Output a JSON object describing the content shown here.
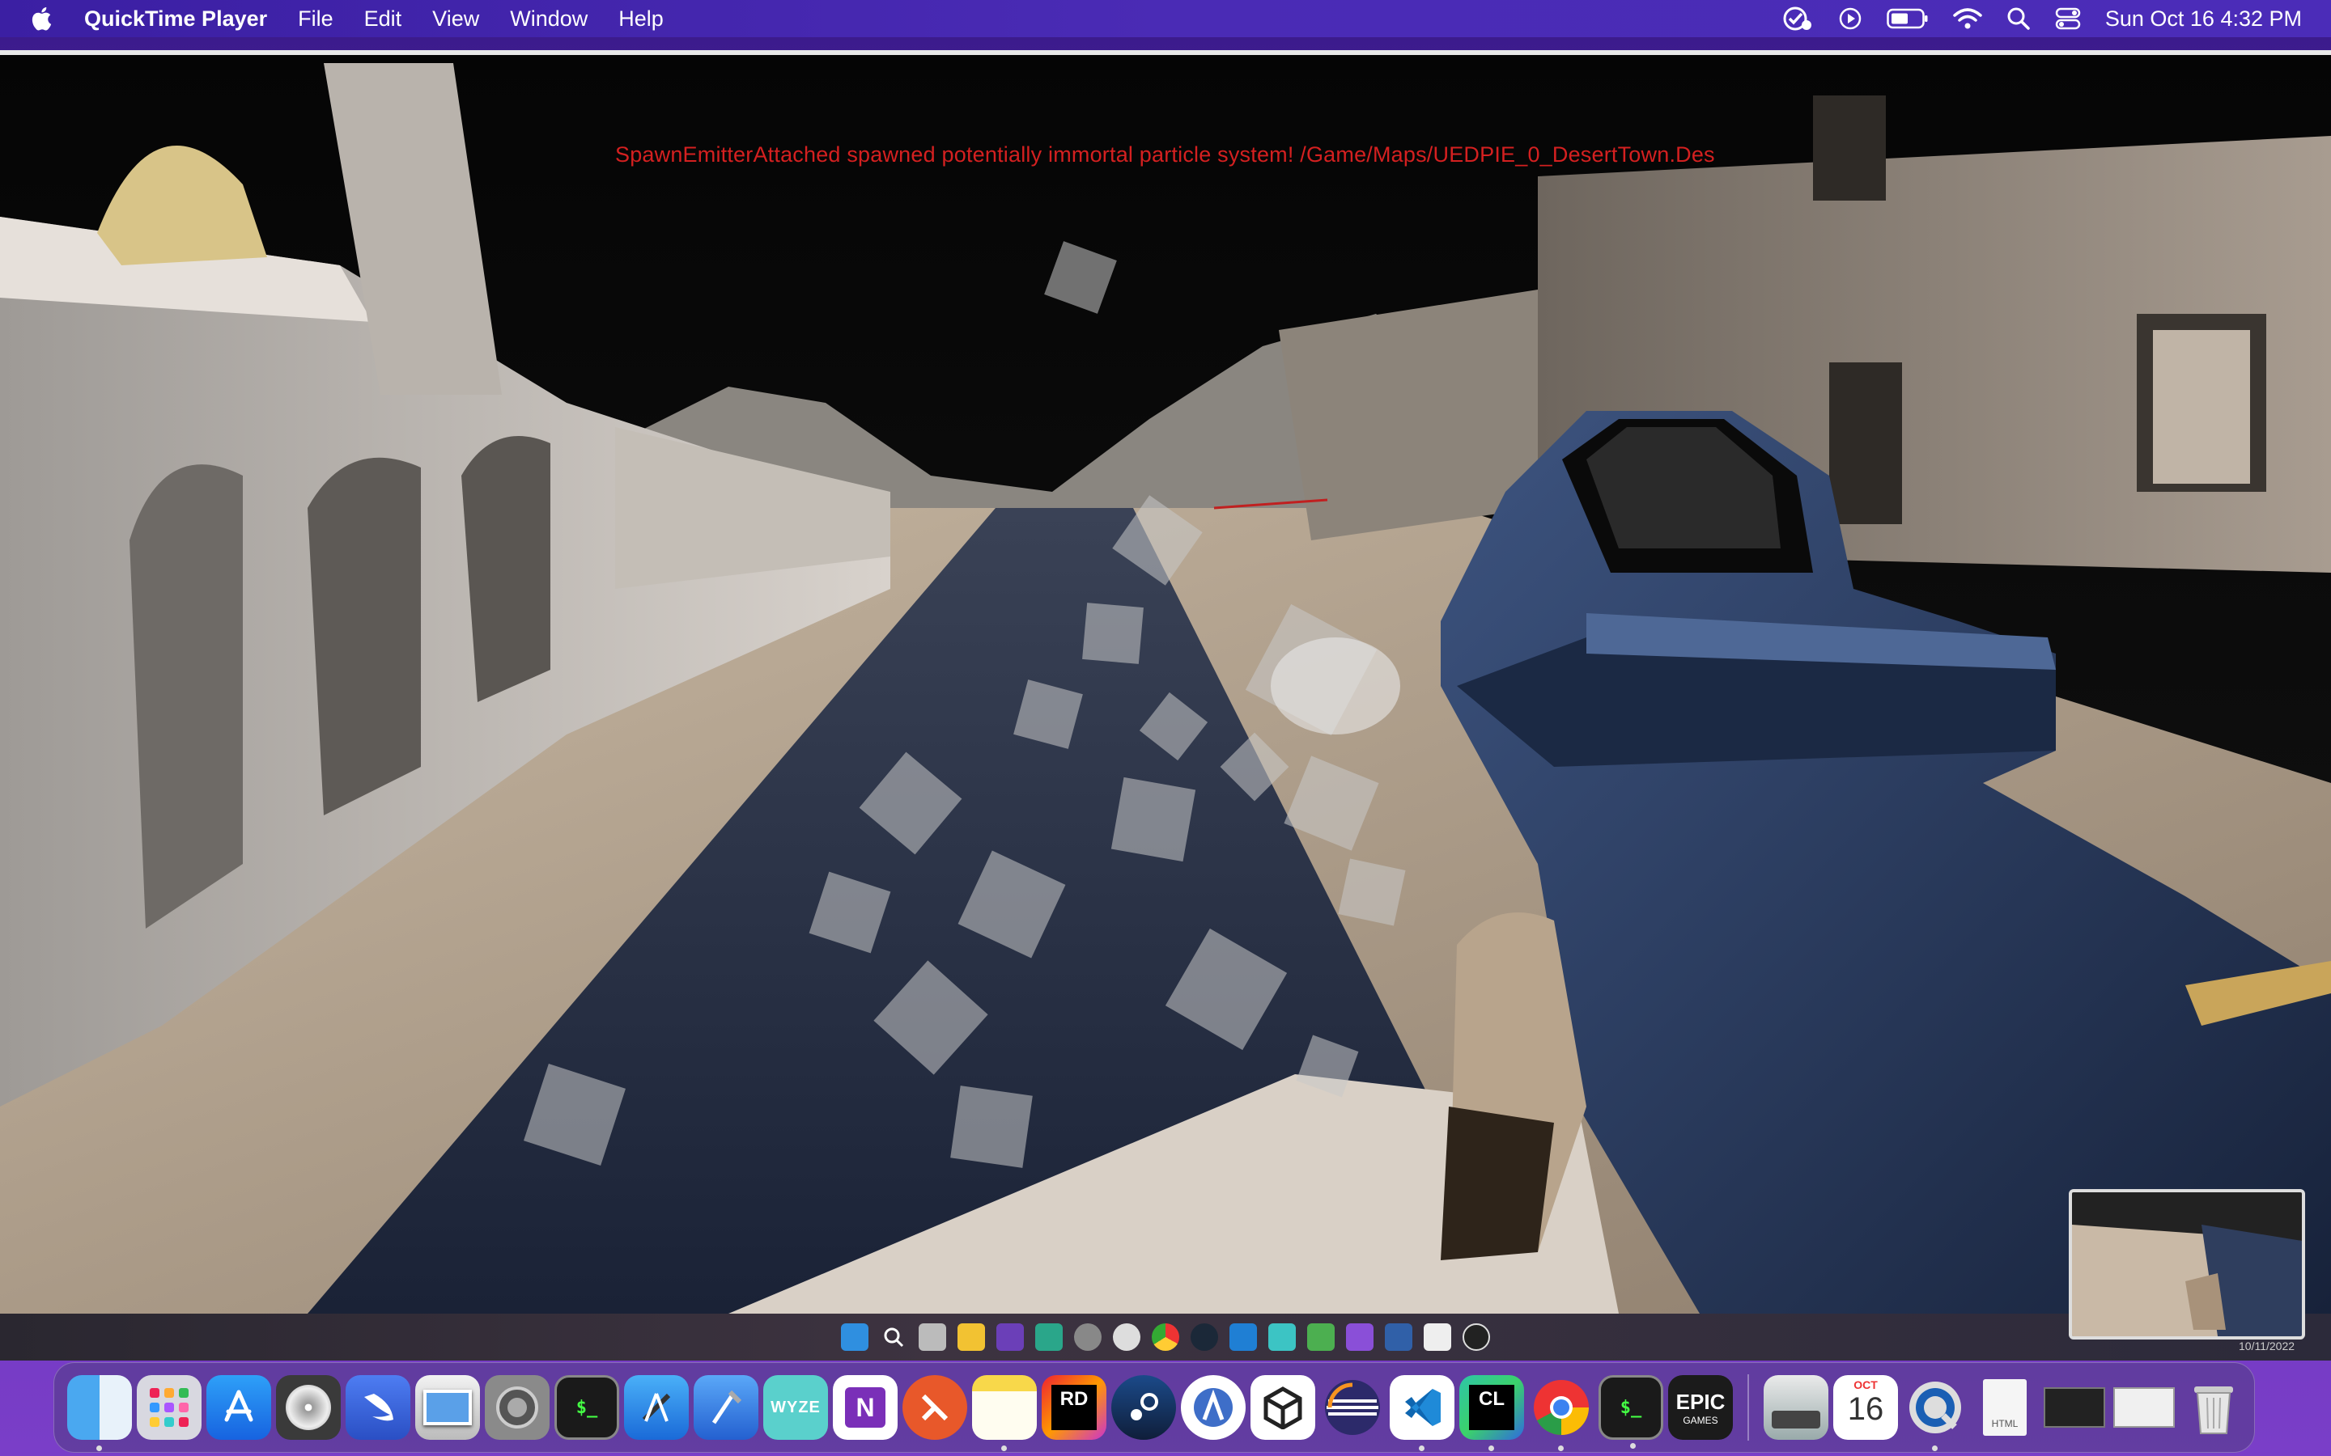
{
  "menubar": {
    "app_name": "QuickTime Player",
    "menus": [
      "File",
      "Edit",
      "View",
      "Window",
      "Help"
    ],
    "clock": "Sun Oct 16  4:32 PM",
    "status_icons": [
      "focus-check-icon",
      "play-circle-icon",
      "battery-icon",
      "wifi-icon",
      "spotlight-search-icon",
      "control-center-icon"
    ]
  },
  "video": {
    "debug_message": "SpawnEmitterAttached spawned potentially immortal particle system! /Game/Maps/UEDPIE_0_DesertTown.Des",
    "thumbnail_date": "10/11/2022"
  },
  "win_taskbar": {
    "icons": [
      "windows-start-icon",
      "search-icon",
      "task-view-icon",
      "file-explorer-icon",
      "visual-studio-icon",
      "app-icon",
      "settings-icon",
      "app-icon",
      "chrome-icon",
      "steam-icon",
      "vscode-icon",
      "app-icon",
      "rider-run-icon",
      "visual-studio-purple-icon",
      "powershell-icon",
      "app-icon",
      "unreal-engine-icon"
    ]
  },
  "dock": {
    "apps": [
      {
        "name": "finder-icon",
        "label": "",
        "running": true
      },
      {
        "name": "launchpad-icon",
        "label": "",
        "running": false
      },
      {
        "name": "app-store-icon",
        "label": "",
        "running": false
      },
      {
        "name": "disk-utility-icon",
        "label": "",
        "running": false
      },
      {
        "name": "swift-playgrounds-icon",
        "label": "",
        "running": false
      },
      {
        "name": "preview-icon",
        "label": "",
        "running": false
      },
      {
        "name": "system-preferences-icon",
        "label": "",
        "running": false
      },
      {
        "name": "terminal-icon",
        "label": "$_",
        "running": false
      },
      {
        "name": "xcode-icon",
        "label": "",
        "running": false
      },
      {
        "name": "instruments-icon",
        "label": "",
        "running": false
      },
      {
        "name": "wyze-icon",
        "label": "WYZE",
        "running": false
      },
      {
        "name": "onenote-icon",
        "label": "N",
        "running": false
      },
      {
        "name": "remote-desktop-icon",
        "label": "",
        "running": false
      },
      {
        "name": "notes-icon",
        "label": "",
        "running": true
      },
      {
        "name": "rider-icon",
        "label": "RD",
        "running": false
      },
      {
        "name": "steam-icon",
        "label": "",
        "running": false
      },
      {
        "name": "android-studio-icon",
        "label": "",
        "running": false
      },
      {
        "name": "unity-icon",
        "label": "",
        "running": false
      },
      {
        "name": "eclipse-icon",
        "label": "",
        "running": false
      },
      {
        "name": "vscode-icon",
        "label": "",
        "running": true
      },
      {
        "name": "clion-icon",
        "label": "CL",
        "running": true
      },
      {
        "name": "chrome-icon",
        "label": "",
        "running": true
      },
      {
        "name": "terminal-icon-2",
        "label": "$_",
        "running": true
      },
      {
        "name": "epic-games-icon",
        "label": "EPIC",
        "running": false
      }
    ],
    "right": [
      {
        "name": "disk-drive-icon",
        "label": "",
        "running": false
      },
      {
        "name": "calendar-icon",
        "label_month": "OCT",
        "label_day": "16",
        "running": false
      },
      {
        "name": "quicktime-icon",
        "label": "",
        "running": true
      },
      {
        "name": "html-file-icon",
        "label": "HTML",
        "running": false
      },
      {
        "name": "window-stack-icon",
        "label": "",
        "running": false
      },
      {
        "name": "screenshot-stack-icon",
        "label": "",
        "running": false
      },
      {
        "name": "trash-icon",
        "label": "",
        "running": false
      }
    ]
  }
}
